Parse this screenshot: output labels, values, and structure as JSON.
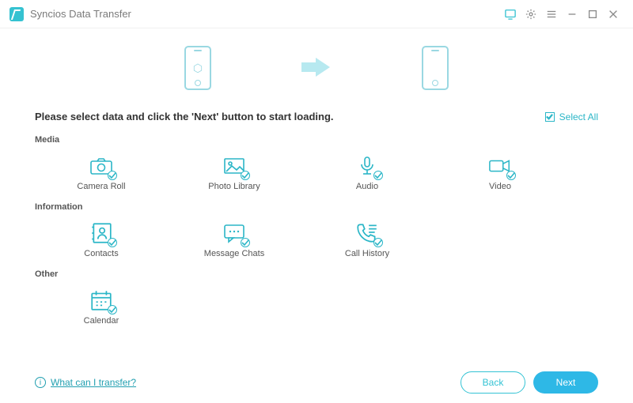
{
  "app_title": "Syncios Data Transfer",
  "instruction": "Please select data and click the 'Next' button to start loading.",
  "select_all": "Select All",
  "groups": {
    "media": {
      "title": "Media",
      "items": [
        "Camera Roll",
        "Photo Library",
        "Audio",
        "Video"
      ]
    },
    "information": {
      "title": "Information",
      "items": [
        "Contacts",
        "Message Chats",
        "Call History"
      ]
    },
    "other": {
      "title": "Other",
      "items": [
        "Calendar"
      ]
    }
  },
  "help_link": "What can I transfer?",
  "buttons": {
    "back": "Back",
    "next": "Next"
  },
  "accent": "#2bb6c7"
}
